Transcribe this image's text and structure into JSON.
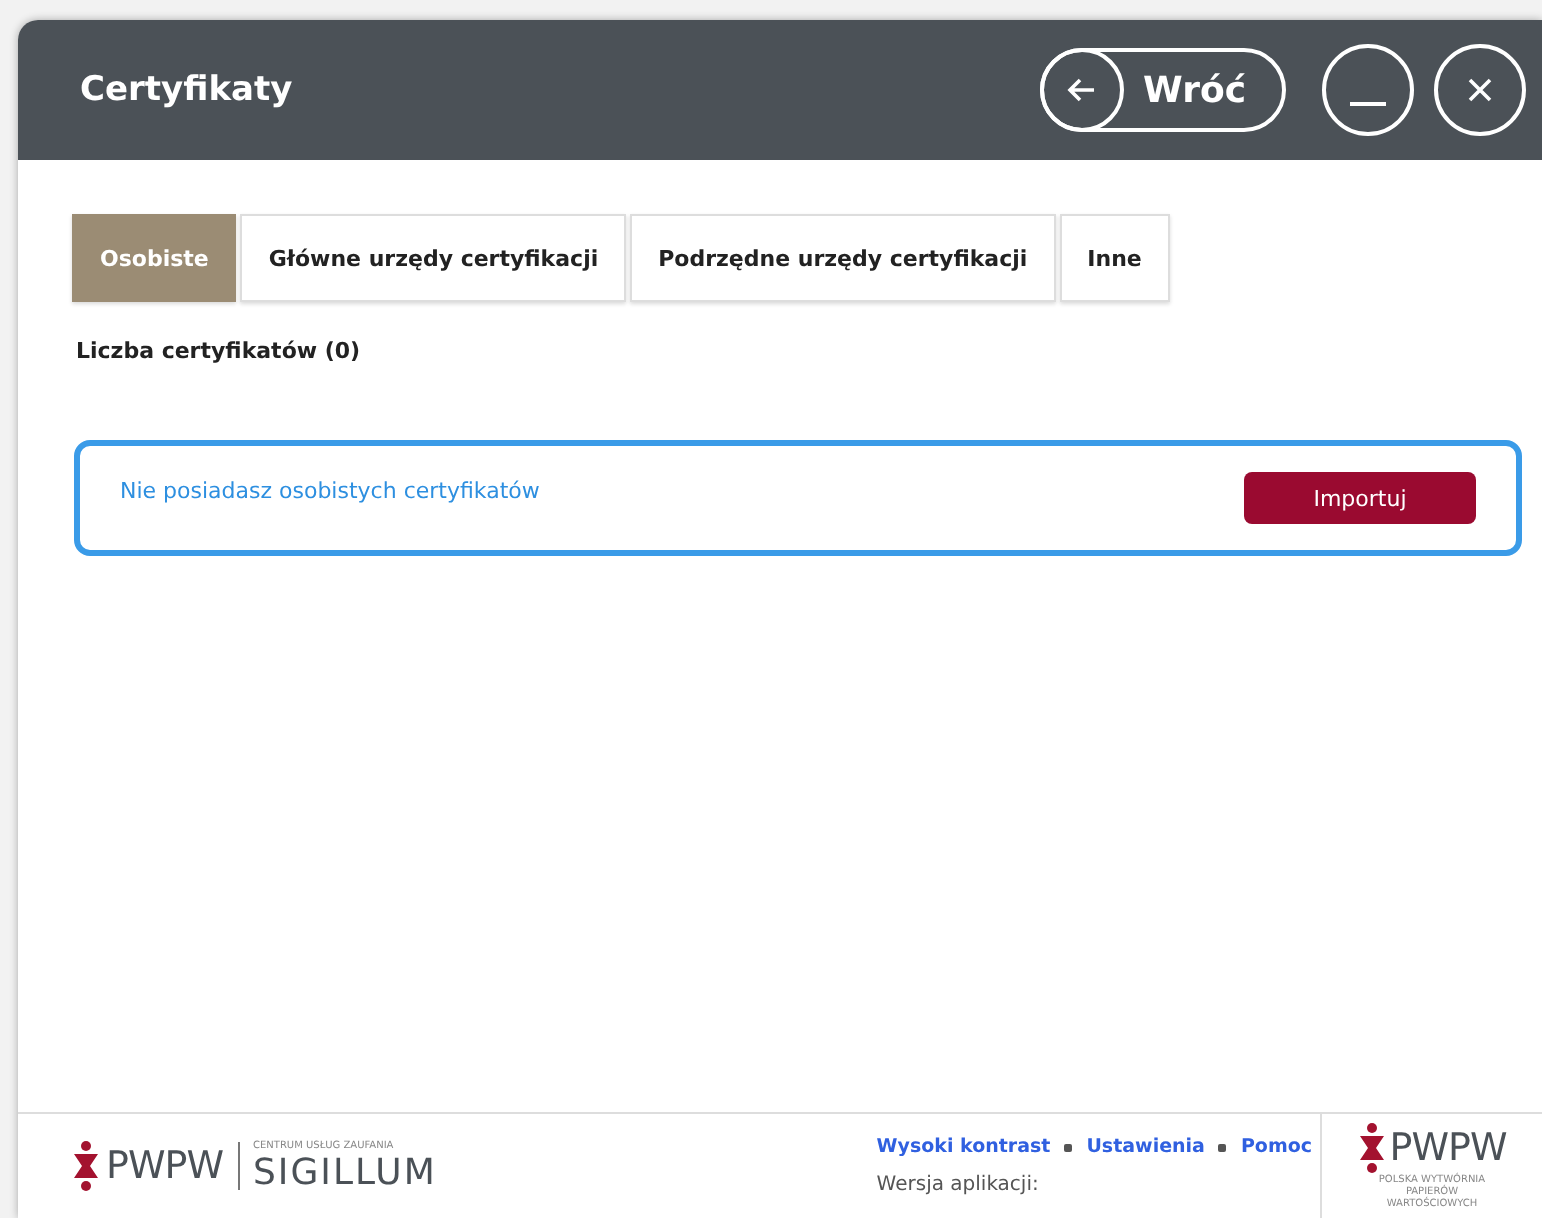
{
  "window": {
    "title": "Certyfikaty"
  },
  "header_buttons": {
    "back": "Wróć"
  },
  "tabs": [
    {
      "label": "Osobiste",
      "selected": true
    },
    {
      "label": "Główne urzędy certyfikacji",
      "selected": false
    },
    {
      "label": "Podrzędne urzędy certyfikacji",
      "selected": false
    },
    {
      "label": "Inne",
      "selected": false
    }
  ],
  "count_label": "Liczba certyfikatów (0)",
  "empty_card": {
    "message": "Nie posiadasz osobistych certyfikatów",
    "button": "Importuj"
  },
  "footer": {
    "logo_left": {
      "brand": "PWPW",
      "caption": "CENTRUM USŁUG ZAUFANIA",
      "product": "SIGILLUM"
    },
    "links": [
      "Wysoki kontrast",
      "Ustawienia",
      "Pomoc"
    ],
    "version": "Wersja aplikacji:",
    "logo_right": {
      "brand": "PWPW",
      "caption": "POLSKA WYTWÓRNIA PAPIERÓW WARTOŚCIOWYCH"
    }
  }
}
